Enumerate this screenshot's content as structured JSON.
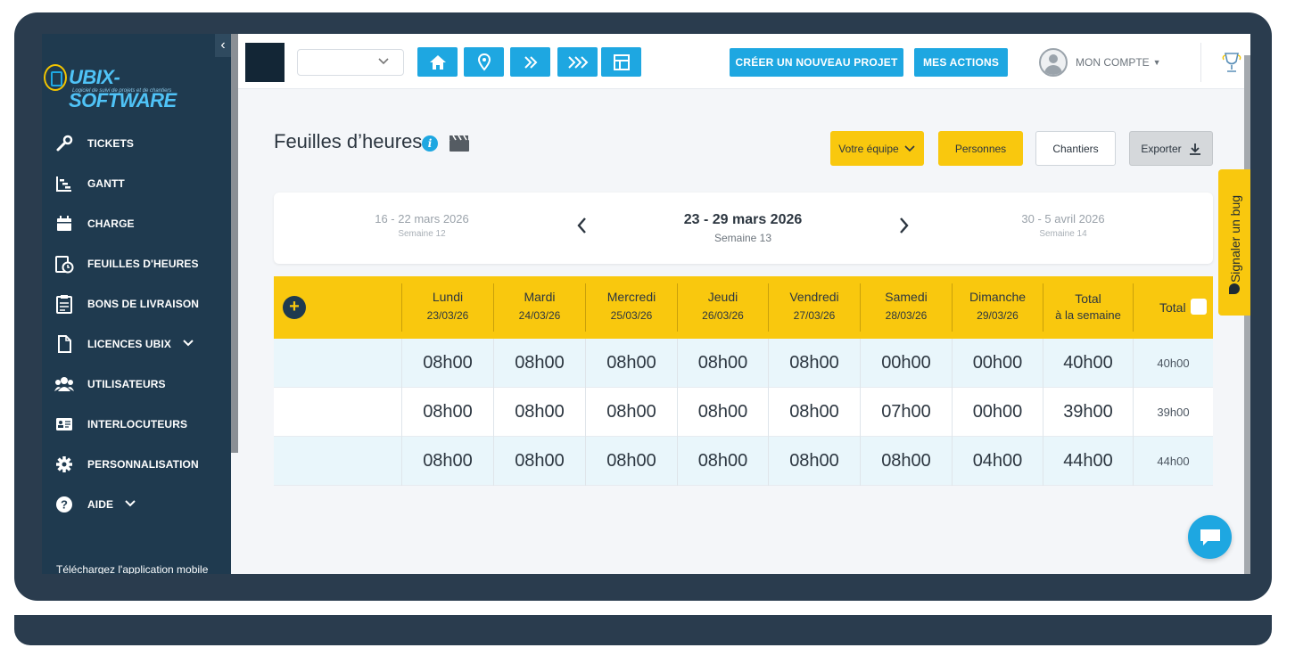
{
  "sidebar": {
    "logo_text": "UBIX-SOFTWARE",
    "logo_sub": "Logiciel de suivi de projets et de chantiers",
    "items": [
      {
        "label": "TICKETS",
        "icon": "wrench-icon"
      },
      {
        "label": "GANTT",
        "icon": "gantt-chart-icon"
      },
      {
        "label": "CHARGE",
        "icon": "calendar-icon"
      },
      {
        "label": "FEUILLES D'HEURES",
        "icon": "timesheet-clock-icon"
      },
      {
        "label": "BONS DE LIVRAISON",
        "icon": "clipboard-icon"
      },
      {
        "label": "LICENCES UBIX",
        "icon": "document-icon",
        "has_chevron": true
      },
      {
        "label": "UTILISATEURS",
        "icon": "users-icon"
      },
      {
        "label": "INTERLOCUTEURS",
        "icon": "contact-card-icon"
      },
      {
        "label": "PERSONNALISATION",
        "icon": "gear-icon"
      },
      {
        "label": "AIDE",
        "icon": "help-icon",
        "has_chevron": true
      }
    ],
    "download_text": "Téléchargez l'application mobile"
  },
  "topbar": {
    "create_project": "CRÉER UN NOUVEAU PROJET",
    "my_actions": "MES ACTIONS",
    "account": "MON COMPTE"
  },
  "page": {
    "title": "Feuilles d’heures"
  },
  "filters": {
    "team": "Votre équipe",
    "persons": "Personnes",
    "sites": "Chantiers",
    "export": "Exporter"
  },
  "weeks": {
    "prev": {
      "range": "16 - 22 mars 2026",
      "label": "Semaine 12"
    },
    "current": {
      "range": "23 - 29 mars 2026",
      "label": "Semaine 13"
    },
    "next": {
      "range": "30 - 5 avril 2026",
      "label": "Semaine 14"
    }
  },
  "table": {
    "days": [
      {
        "name": "Lundi",
        "date": "23/03/26"
      },
      {
        "name": "Mardi",
        "date": "24/03/26"
      },
      {
        "name": "Mercredi",
        "date": "25/03/26"
      },
      {
        "name": "Jeudi",
        "date": "26/03/26"
      },
      {
        "name": "Vendredi",
        "date": "27/03/26"
      },
      {
        "name": "Samedi",
        "date": "28/03/26"
      },
      {
        "name": "Dimanche",
        "date": "29/03/26"
      }
    ],
    "total_week_line1": "Total",
    "total_week_line2": "à la semaine",
    "total_label": "Total",
    "rows": [
      {
        "days": [
          "08h00",
          "08h00",
          "08h00",
          "08h00",
          "08h00",
          "00h00",
          "00h00"
        ],
        "week_total": "40h00",
        "total": "40h00"
      },
      {
        "days": [
          "08h00",
          "08h00",
          "08h00",
          "08h00",
          "08h00",
          "07h00",
          "00h00"
        ],
        "week_total": "39h00",
        "total": "39h00"
      },
      {
        "days": [
          "08h00",
          "08h00",
          "08h00",
          "08h00",
          "08h00",
          "08h00",
          "04h00"
        ],
        "week_total": "44h00",
        "total": "44h00"
      }
    ]
  },
  "bug_tab": "Signaler un bug",
  "colors": {
    "sidebar": "#1f3a4f",
    "accent_blue": "#1ea7e1",
    "accent_yellow": "#f9c80e"
  }
}
